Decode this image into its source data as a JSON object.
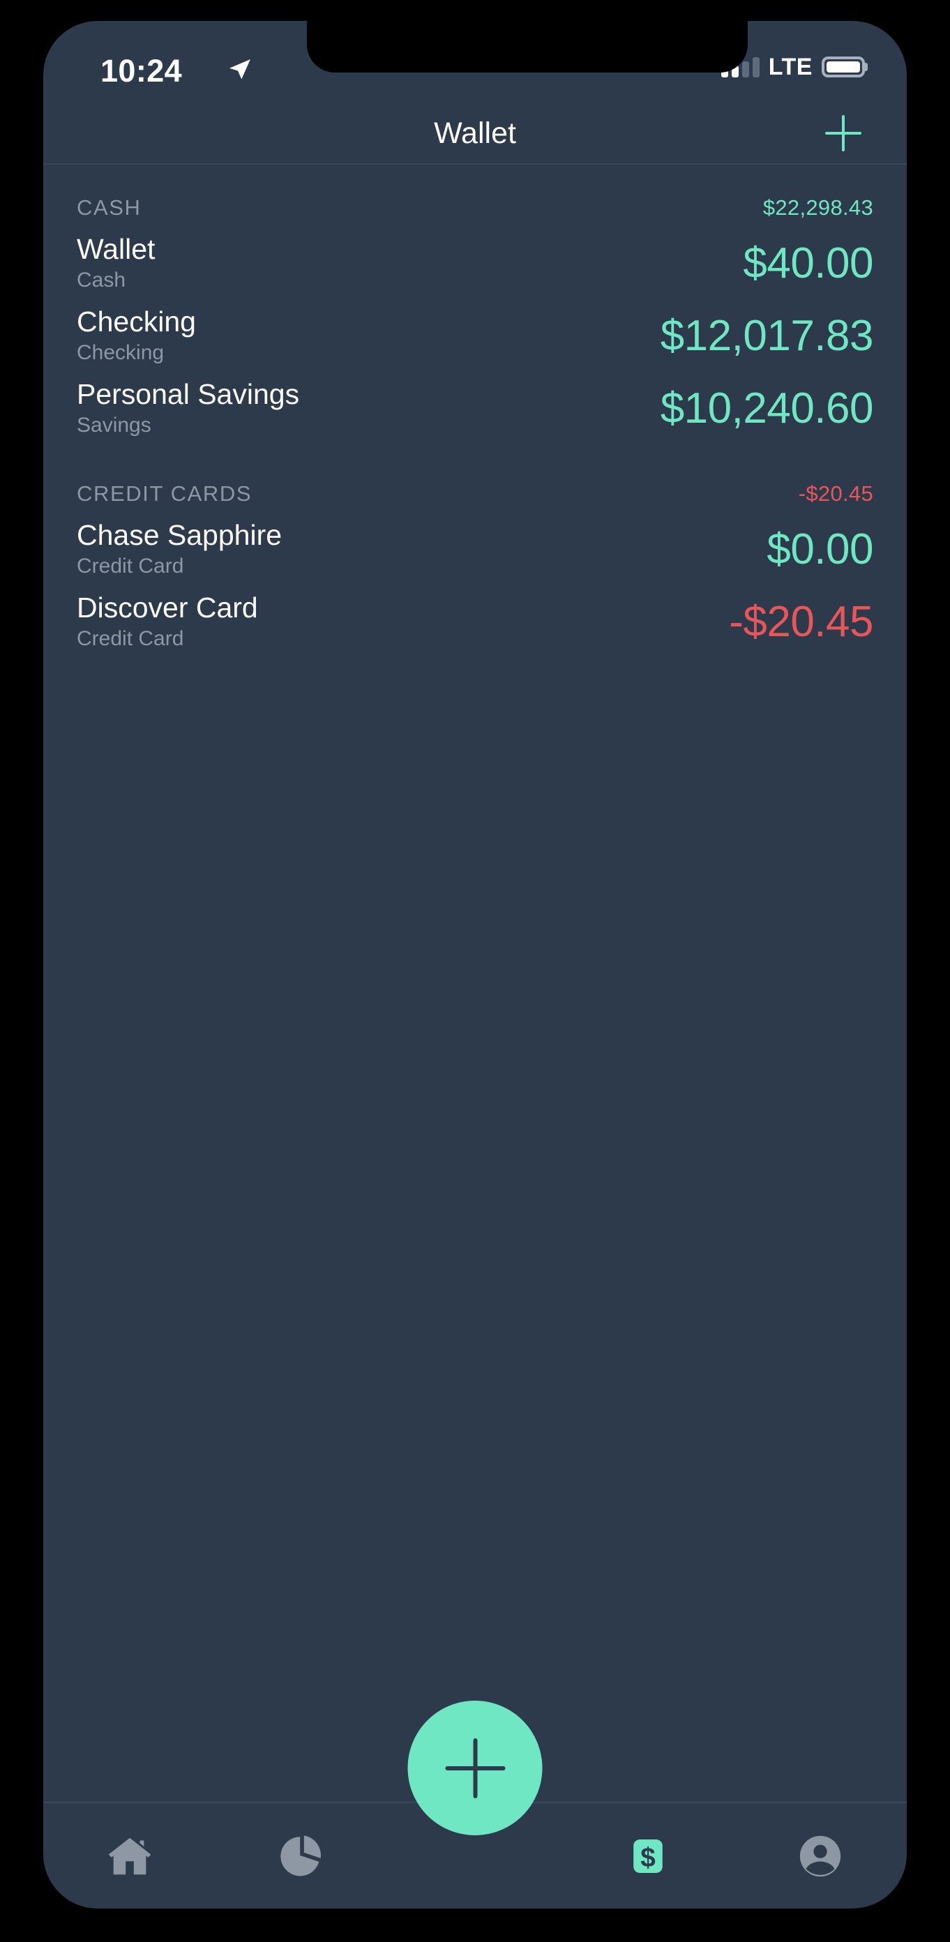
{
  "status_bar": {
    "time": "10:24",
    "location_icon": "location-arrow-icon",
    "signal_bars_total": 4,
    "signal_bars_filled": 2,
    "network": "LTE",
    "battery_icon": "battery-full-icon",
    "battery_level_pct": 100
  },
  "header": {
    "title": "Wallet",
    "add_icon": "plus-icon"
  },
  "sections": [
    {
      "title": "CASH",
      "total": "$22,298.43",
      "total_sign": "pos",
      "accounts": [
        {
          "name": "Wallet",
          "type": "Cash",
          "balance": "$40.00",
          "sign": "pos"
        },
        {
          "name": "Checking",
          "type": "Checking",
          "balance": "$12,017.83",
          "sign": "pos"
        },
        {
          "name": "Personal Savings",
          "type": "Savings",
          "balance": "$10,240.60",
          "sign": "pos"
        }
      ]
    },
    {
      "title": "CREDIT CARDS",
      "total": "-$20.45",
      "total_sign": "neg",
      "accounts": [
        {
          "name": "Chase Sapphire",
          "type": "Credit Card",
          "balance": "$0.00",
          "sign": "pos"
        },
        {
          "name": "Discover Card",
          "type": "Credit Card",
          "balance": "-$20.45",
          "sign": "neg"
        }
      ]
    }
  ],
  "tabbar": {
    "items": [
      {
        "icon": "home-icon",
        "active": false
      },
      {
        "icon": "pie-chart-icon",
        "active": false
      },
      {
        "icon": "wallet-dollar-icon",
        "active": true
      },
      {
        "icon": "profile-icon",
        "active": false
      }
    ],
    "fab_icon": "plus-icon"
  },
  "colors": {
    "background": "#2c3a4b",
    "accent_mint": "#6fe7c3",
    "negative_red": "#e8565a",
    "muted_gray": "#8e98a5",
    "text_white": "#ffffff"
  }
}
